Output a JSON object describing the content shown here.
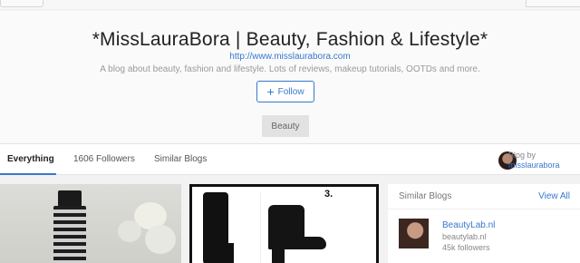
{
  "blog": {
    "title": "*MissLauraBora | Beauty, Fashion & Lifestyle*",
    "url": "http://www.misslaurabora.com",
    "description": "A blog about beauty, fashion and lifestyle. Lots of reviews, makeup tutorials, OOTDs and more.",
    "follow_label": "Follow",
    "follow_icon": "plus-icon",
    "category_tag": "Beauty"
  },
  "tabs": [
    {
      "label": "Everything",
      "active": true
    },
    {
      "label": "1606 Followers",
      "active": false
    },
    {
      "label": "Similar Blogs",
      "active": false
    }
  ],
  "blog_by": {
    "label": "Blog by",
    "author": "misslaurabora"
  },
  "posts": [
    {
      "kind": "nail-polish-photo"
    },
    {
      "kind": "boots-collage",
      "number_label": "3."
    }
  ],
  "similar_blogs": {
    "heading": "Similar Blogs",
    "view_all": "View All",
    "items": [
      {
        "name": "BeautyLab.nl",
        "domain": "beautylab.nl",
        "followers": "45k followers"
      }
    ]
  },
  "colors": {
    "accent": "#3778cd",
    "text": "#222222",
    "muted": "#9a9a9a",
    "background": "#f2f2f2"
  }
}
